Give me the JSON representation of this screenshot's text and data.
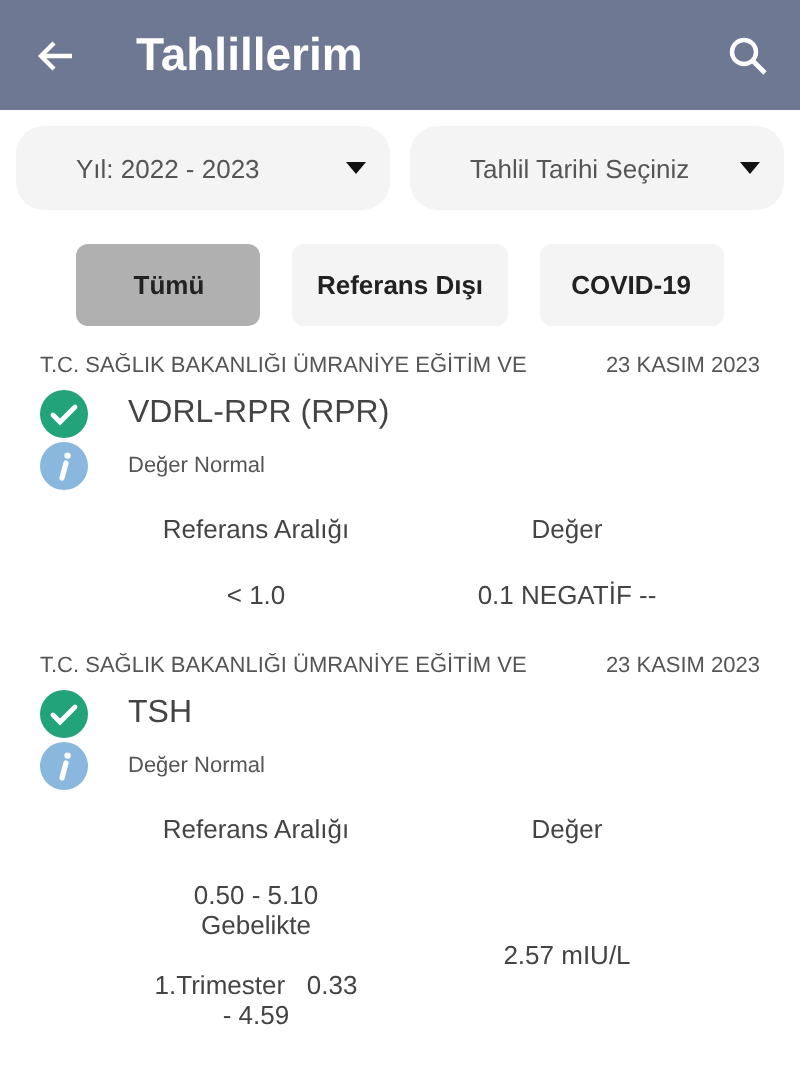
{
  "header": {
    "title": "Tahlillerim"
  },
  "dropdowns": [
    {
      "value": "Yıl: 2022 - 2023"
    },
    {
      "value": "Tahlil Tarihi Seçiniz"
    }
  ],
  "filters": [
    {
      "label": "Tümü",
      "selected": true
    },
    {
      "label": "Referans Dışı",
      "selected": false
    },
    {
      "label": "COVID-19",
      "selected": false
    }
  ],
  "results": [
    {
      "institution": "T.C. SAĞLIK BAKANLIĞI ÜMRANİYE EĞİTİM VE",
      "date": "23 KASIM 2023",
      "test": "VDRL-RPR (RPR)",
      "normal": true,
      "status": "Değer Normal",
      "reference_header": "Referans Aralığı",
      "value_header": "Değer",
      "reference": "< 1.0",
      "value": "0.1 NEGATİF --"
    },
    {
      "institution": "T.C. SAĞLIK BAKANLIĞI ÜMRANİYE EĞİTİM VE",
      "date": "23 KASIM 2023",
      "test": "TSH",
      "normal": true,
      "status": "Değer Normal",
      "reference_header": "Referans Aralığı",
      "value_header": "Değer",
      "reference": "0.50 - 5.10\nGebelikte\n\n1.Trimester   0.33\n- 4.59",
      "value": "2.57 mIU/L"
    }
  ]
}
